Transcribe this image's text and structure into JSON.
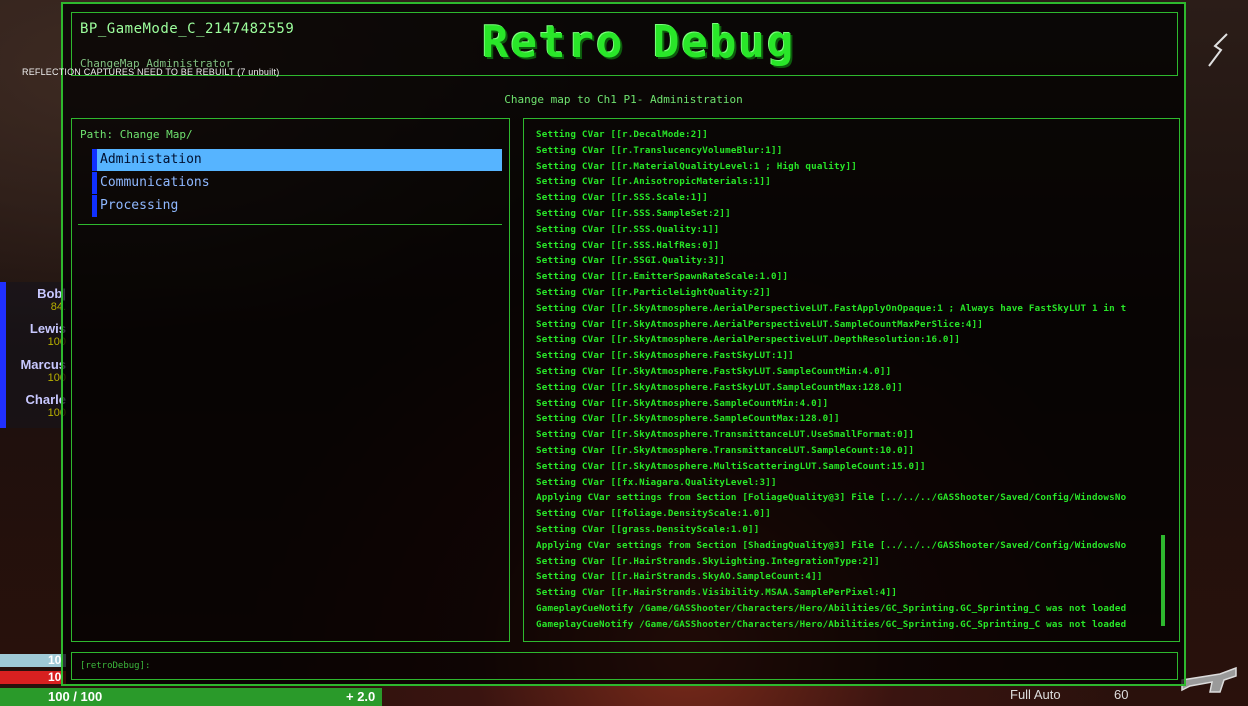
{
  "game": {
    "reflection_warning": "REFLECTION CAPTURES NEED TO BE REBUILT (7 unbuilt)",
    "party": [
      {
        "name": "Bob|",
        "hp": "84."
      },
      {
        "name": "Lewis",
        "hp": "100"
      },
      {
        "name": "Marcus",
        "hp": "100"
      },
      {
        "name": "Charle",
        "hp": "100"
      }
    ],
    "shield_value": "10",
    "health_value": "10",
    "stamina_text": "100 / 100",
    "stamina_regen": "+ 2.0",
    "weapon_mode": "Full Auto",
    "ammo": "60",
    "icons": {
      "weapon": "rifle-icon",
      "crosshair": "crosshair-icon"
    }
  },
  "debug": {
    "gamemode_name": "BP_GameMode_C_2147482559",
    "gamemode_sub": "ChangeMap Administrator",
    "title": "Retro Debug",
    "subtitle": "Change map to Ch1 P1- Administration",
    "path_label": "Path: Change Map/",
    "menu_items": [
      "Administation",
      "Communications",
      "Processing"
    ],
    "selected_index": 0,
    "console_prompt": "[retroDebug]:",
    "colors": {
      "accent": "#2eb82e",
      "selected": "#56b4ff",
      "title": "#29e629"
    },
    "log": [
      "Setting CVar [[r.DecalMode:2]]",
      "Setting CVar [[r.TranslucencyVolumeBlur:1]]",
      "Setting CVar [[r.MaterialQualityLevel:1 ; High quality]]",
      "Setting CVar [[r.AnisotropicMaterials:1]]",
      "Setting CVar [[r.SSS.Scale:1]]",
      "Setting CVar [[r.SSS.SampleSet:2]]",
      "Setting CVar [[r.SSS.Quality:1]]",
      "Setting CVar [[r.SSS.HalfRes:0]]",
      "Setting CVar [[r.SSGI.Quality:3]]",
      "Setting CVar [[r.EmitterSpawnRateScale:1.0]]",
      "Setting CVar [[r.ParticleLightQuality:2]]",
      "Setting CVar [[r.SkyAtmosphere.AerialPerspectiveLUT.FastApplyOnOpaque:1 ; Always have FastSkyLUT 1 in t",
      "Setting CVar [[r.SkyAtmosphere.AerialPerspectiveLUT.SampleCountMaxPerSlice:4]]",
      "Setting CVar [[r.SkyAtmosphere.AerialPerspectiveLUT.DepthResolution:16.0]]",
      "Setting CVar [[r.SkyAtmosphere.FastSkyLUT:1]]",
      "Setting CVar [[r.SkyAtmosphere.FastSkyLUT.SampleCountMin:4.0]]",
      "Setting CVar [[r.SkyAtmosphere.FastSkyLUT.SampleCountMax:128.0]]",
      "Setting CVar [[r.SkyAtmosphere.SampleCountMin:4.0]]",
      "Setting CVar [[r.SkyAtmosphere.SampleCountMax:128.0]]",
      "Setting CVar [[r.SkyAtmosphere.TransmittanceLUT.UseSmallFormat:0]]",
      "Setting CVar [[r.SkyAtmosphere.TransmittanceLUT.SampleCount:10.0]]",
      "Setting CVar [[r.SkyAtmosphere.MultiScatteringLUT.SampleCount:15.0]]",
      "Setting CVar [[fx.Niagara.QualityLevel:3]]",
      "Applying CVar settings from Section [FoliageQuality@3] File [../../../GASShooter/Saved/Config/WindowsNo",
      "Setting CVar [[foliage.DensityScale:1.0]]",
      "Setting CVar [[grass.DensityScale:1.0]]",
      "Applying CVar settings from Section [ShadingQuality@3] File [../../../GASShooter/Saved/Config/WindowsNo",
      "Setting CVar [[r.HairStrands.SkyLighting.IntegrationType:2]]",
      "Setting CVar [[r.HairStrands.SkyAO.SampleCount:4]]",
      "Setting CVar [[r.HairStrands.Visibility.MSAA.SamplePerPixel:4]]",
      "GameplayCueNotify /Game/GASShooter/Characters/Hero/Abilities/GC_Sprinting.GC_Sprinting_C was not loaded",
      "GameplayCueNotify /Game/GASShooter/Characters/Hero/Abilities/GC_Sprinting.GC_Sprinting_C was not loaded"
    ]
  }
}
